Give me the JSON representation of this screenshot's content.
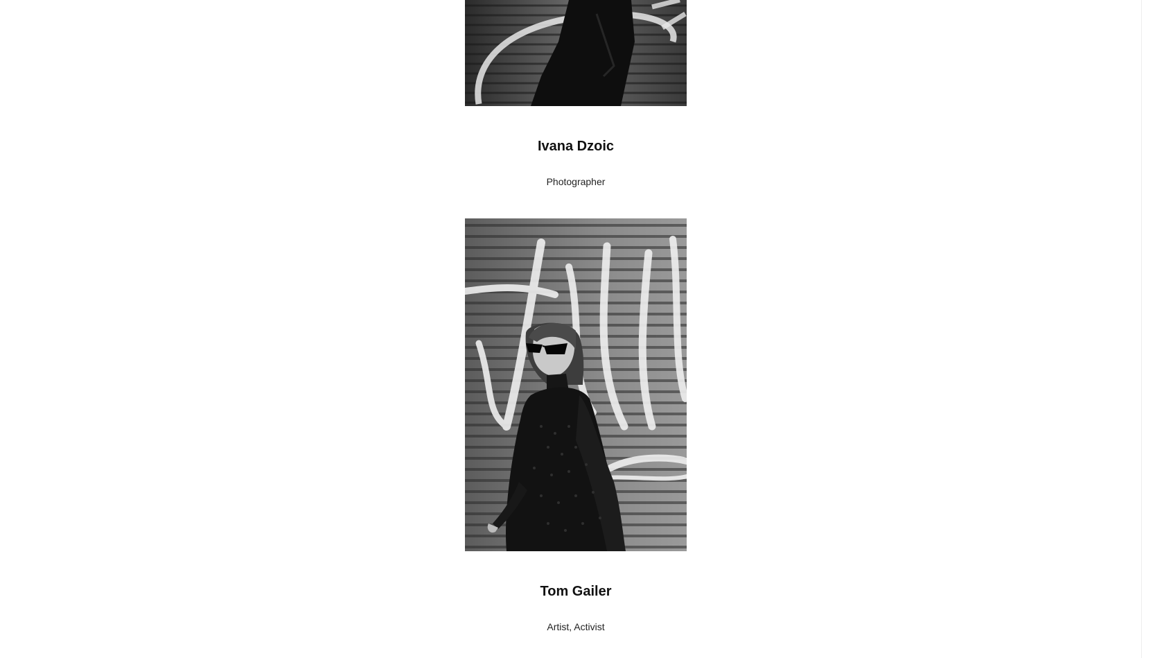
{
  "team": {
    "members": [
      {
        "name": "Ivana Dzoic",
        "role": "Photographer",
        "photo": "portrait-photo-bw-graffiti-shutter"
      },
      {
        "name": "Tom Gailer",
        "role": "Artist, Activist",
        "photo": "portrait-photo-bw-woman-sunglasses-graffiti"
      }
    ]
  },
  "colors": {
    "background": "#ffffff",
    "text": "#111111"
  }
}
